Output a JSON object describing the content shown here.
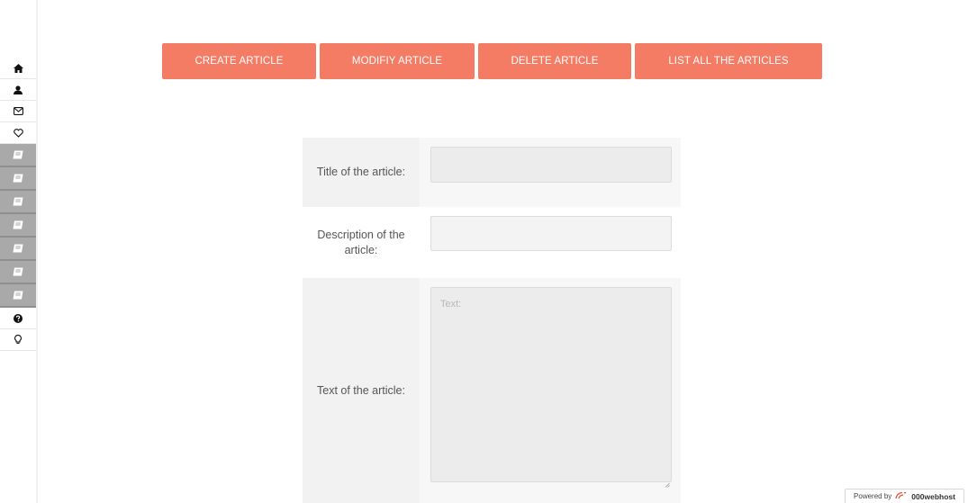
{
  "toolbar": {
    "buttons": [
      {
        "label": "CREATE ARTICLE"
      },
      {
        "label": "MODIFIY ARTICLE"
      },
      {
        "label": "DELETE ARTICLE"
      },
      {
        "label": "LIST ALL THE ARTICLES"
      }
    ]
  },
  "form": {
    "title_label": "Title of the article:",
    "title_value": "",
    "description_label": "Description of the article:",
    "description_value": "",
    "text_label": "Text of the article:",
    "text_placeholder": "Text:"
  },
  "sidebar": {
    "icons": [
      "home-icon",
      "user-icon",
      "envelope-icon",
      "heart-icon",
      "article-icon",
      "article-icon",
      "article-icon",
      "article-icon",
      "article-icon",
      "article-icon",
      "article-icon",
      "question-icon",
      "lightbulb-icon"
    ]
  },
  "footer": {
    "powered_by": "Powered by",
    "brand": "000webhost"
  },
  "colors": {
    "accent": "#f47c65",
    "sidebar_active": "#a9a9a9"
  }
}
